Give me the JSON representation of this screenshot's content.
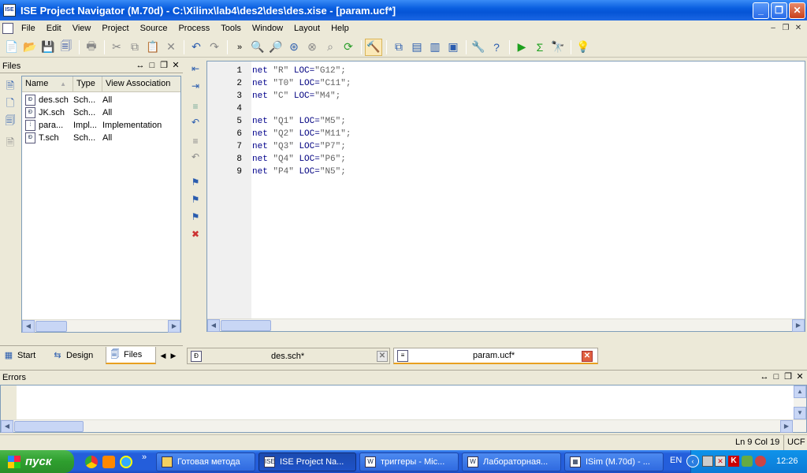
{
  "window": {
    "title": "ISE Project Navigator (M.70d) - C:\\Xilinx\\lab4\\des2\\des\\des.xise - [param.ucf*]",
    "app_icon": "ISE"
  },
  "menu": [
    "File",
    "Edit",
    "View",
    "Project",
    "Source",
    "Process",
    "Tools",
    "Window",
    "Layout",
    "Help"
  ],
  "files_panel": {
    "title": "Files",
    "columns": [
      "Name",
      "Type",
      "View Association"
    ],
    "rows": [
      {
        "name": "des.sch",
        "type": "Sch...",
        "view": "All"
      },
      {
        "name": "JK.sch",
        "type": "Sch...",
        "view": "All"
      },
      {
        "name": "para...",
        "type": "Impl...",
        "view": "Implementation"
      },
      {
        "name": "T.sch",
        "type": "Sch...",
        "view": "All"
      }
    ]
  },
  "left_tabs": [
    "Start",
    "Design",
    "Files"
  ],
  "editor": {
    "lines": [
      {
        "n": "1",
        "kw": "net",
        "sig": "\"R\"",
        "loc": "LOC=",
        "pin": "\"G12\";"
      },
      {
        "n": "2",
        "kw": "net",
        "sig": "\"T0\"",
        "loc": "LOC=",
        "pin": "\"C11\";"
      },
      {
        "n": "3",
        "kw": "net",
        "sig": "\"C\"",
        "loc": "LOC=",
        "pin": "\"M4\";"
      },
      {
        "n": "4",
        "kw": "",
        "sig": "",
        "loc": "",
        "pin": ""
      },
      {
        "n": "5",
        "kw": "net",
        "sig": "\"Q1\"",
        "loc": "LOC=",
        "pin": "\"M5\";"
      },
      {
        "n": "6",
        "kw": "net",
        "sig": "\"Q2\"",
        "loc": "LOC=",
        "pin": "\"M11\";"
      },
      {
        "n": "7",
        "kw": "net",
        "sig": "\"Q3\"",
        "loc": "LOC=",
        "pin": "\"P7\";"
      },
      {
        "n": "8",
        "kw": "net",
        "sig": "\"Q4\"",
        "loc": "LOC=",
        "pin": "\"P6\";"
      },
      {
        "n": "9",
        "kw": "net",
        "sig": "\"P4\"",
        "loc": "LOC=",
        "pin": "\"N5\";"
      }
    ],
    "tabs": [
      {
        "label": "des.sch*"
      },
      {
        "label": "param.ucf*"
      }
    ]
  },
  "errors_panel": {
    "title": "Errors"
  },
  "status": {
    "position": "Ln 9 Col 19",
    "filetype": "UCF"
  },
  "taskbar": {
    "start": "пуск",
    "tasks": [
      "Готовая метода",
      "ISE Project Na...",
      "триггеры - Mic...",
      "Лабораторная...",
      "ISim (M.70d) - ..."
    ],
    "lang": "EN",
    "clock": "12:26"
  }
}
